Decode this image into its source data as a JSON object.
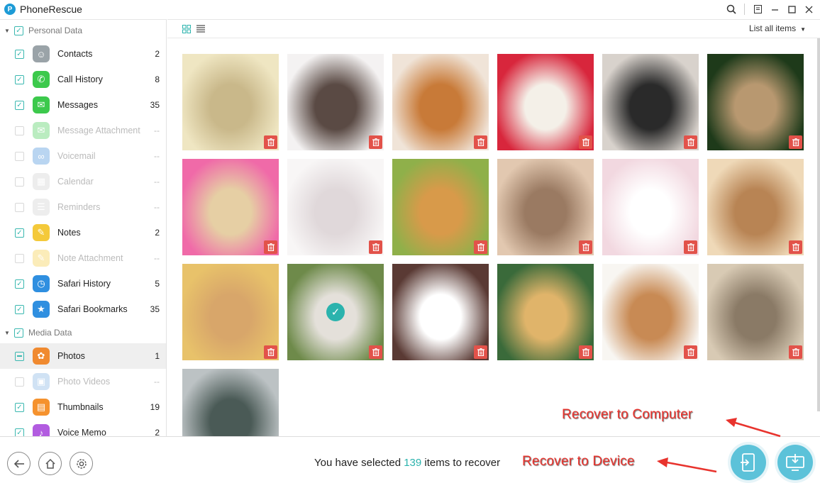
{
  "app": {
    "title": "PhoneRescue",
    "logo_letter": "P"
  },
  "window_controls": [
    "search-icon",
    "menu-icon",
    "minimize-icon",
    "maximize-icon",
    "close-icon"
  ],
  "sidebar": {
    "groups": [
      {
        "label": "Personal Data",
        "items": [
          {
            "label": "Contacts",
            "count": "2",
            "checked": true,
            "enabled": true,
            "icon": "contacts-icon",
            "color": "#9aa3a8"
          },
          {
            "label": "Call History",
            "count": "8",
            "checked": true,
            "enabled": true,
            "icon": "phone-icon",
            "color": "#3cc94c"
          },
          {
            "label": "Messages",
            "count": "35",
            "checked": true,
            "enabled": true,
            "icon": "message-icon",
            "color": "#3cc94c"
          },
          {
            "label": "Message Attachment",
            "count": "--",
            "checked": false,
            "enabled": false,
            "icon": "attachment-icon",
            "color": "#3cc94c"
          },
          {
            "label": "Voicemail",
            "count": "--",
            "checked": false,
            "enabled": false,
            "icon": "voicemail-icon",
            "color": "#3a88d8"
          },
          {
            "label": "Calendar",
            "count": "--",
            "checked": false,
            "enabled": false,
            "icon": "calendar-icon",
            "color": "#cccccc"
          },
          {
            "label": "Reminders",
            "count": "--",
            "checked": false,
            "enabled": false,
            "icon": "reminders-icon",
            "color": "#cccccc"
          },
          {
            "label": "Notes",
            "count": "2",
            "checked": true,
            "enabled": true,
            "icon": "notes-icon",
            "color": "#f4c93a"
          },
          {
            "label": "Note Attachment",
            "count": "--",
            "checked": false,
            "enabled": false,
            "icon": "note-attachment-icon",
            "color": "#f4c93a"
          },
          {
            "label": "Safari History",
            "count": "5",
            "checked": true,
            "enabled": true,
            "icon": "safari-icon",
            "color": "#2f8fe0"
          },
          {
            "label": "Safari Bookmarks",
            "count": "35",
            "checked": true,
            "enabled": true,
            "icon": "bookmarks-icon",
            "color": "#2f8fe0"
          }
        ]
      },
      {
        "label": "Media Data",
        "items": [
          {
            "label": "Photos",
            "count": "1",
            "checked": "partial",
            "enabled": true,
            "selected": true,
            "icon": "photos-icon",
            "color": "#f08a30"
          },
          {
            "label": "Photo Videos",
            "count": "--",
            "checked": false,
            "enabled": false,
            "icon": "photo-videos-icon",
            "color": "#7aaee0"
          },
          {
            "label": "Thumbnails",
            "count": "19",
            "checked": true,
            "enabled": true,
            "icon": "thumbnails-icon",
            "color": "#f5922e"
          },
          {
            "label": "Voice Memo",
            "count": "2",
            "checked": true,
            "enabled": true,
            "icon": "voice-memo-icon",
            "color": "#b25ce0"
          }
        ]
      }
    ]
  },
  "toolbar": {
    "filter_label": "List all items"
  },
  "photos": [
    {
      "subject": "kitten in hat",
      "colors": [
        "#efe6c2",
        "#c9b88a"
      ]
    },
    {
      "subject": "sleeping kitten",
      "colors": [
        "#f4f2f2",
        "#5a4a44"
      ]
    },
    {
      "subject": "pomeranian puppy",
      "colors": [
        "#f0e4d8",
        "#c87a38"
      ]
    },
    {
      "subject": "white puppy",
      "colors": [
        "#d8263c",
        "#f4f0e8"
      ]
    },
    {
      "subject": "two cats",
      "colors": [
        "#d8d2cc",
        "#2a2a2a"
      ]
    },
    {
      "subject": "tabby kitten",
      "colors": [
        "#1e3a1a",
        "#b89870"
      ]
    },
    {
      "subject": "sleeping puppy pink",
      "colors": [
        "#f06aa8",
        "#e6cfa4"
      ]
    },
    {
      "subject": "white kitten",
      "colors": [
        "#f8f6f6",
        "#e0d8da"
      ]
    },
    {
      "subject": "kittens and puppy",
      "colors": [
        "#8fb04a",
        "#d89a4a"
      ]
    },
    {
      "subject": "hamster",
      "colors": [
        "#e2c8b0",
        "#9a7a62"
      ]
    },
    {
      "subject": "sleeping white cat",
      "colors": [
        "#f2d8e0",
        "#ffffff"
      ]
    },
    {
      "subject": "ginger kitten",
      "colors": [
        "#efd9b8",
        "#b88454"
      ]
    },
    {
      "subject": "dog with sign",
      "colors": [
        "#e8c26a",
        "#d8a66a"
      ]
    },
    {
      "subject": "bunny",
      "colors": [
        "#6e8a4a",
        "#e4e0da"
      ],
      "selected": true
    },
    {
      "subject": "white pomeranian",
      "colors": [
        "#5a3a34",
        "#ffffff"
      ]
    },
    {
      "subject": "golden puppy",
      "colors": [
        "#3a6a3a",
        "#e0b46a"
      ]
    },
    {
      "subject": "lop bunny",
      "colors": [
        "#f8f6f2",
        "#c88a54"
      ]
    },
    {
      "subject": "kitten close-up",
      "colors": [
        "#d8cab4",
        "#8a7a66"
      ]
    },
    {
      "subject": "desk items",
      "colors": [
        "#bcc2c4",
        "#4a5a56"
      ]
    }
  ],
  "footer": {
    "status_prefix": "You have selected",
    "selected_count": "139",
    "status_suffix": "items to recover",
    "annotation_computer": "Recover to Computer",
    "annotation_device": "Recover to Device"
  },
  "colors": {
    "accent": "#2bb3ad",
    "recover_button": "#5cc2d9",
    "delete": "#e2524a",
    "annotation": "#e8332d"
  }
}
